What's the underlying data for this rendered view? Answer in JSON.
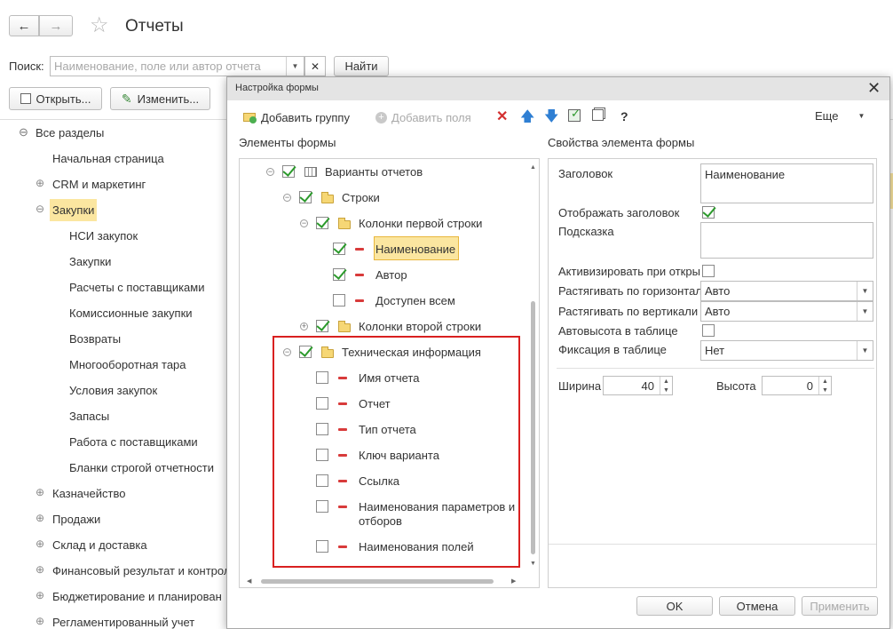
{
  "main": {
    "title": "Отчеты",
    "search_label": "Поиск:",
    "search_placeholder": "Наименование, поле или автор отчета",
    "find_button": "Найти",
    "open_button": "Открыть...",
    "edit_button": "Изменить...",
    "back_icon": "arrow-left-icon",
    "forward_icon": "arrow-right-icon",
    "star_icon": "star-icon"
  },
  "sections": {
    "root": "Все разделы",
    "items": [
      "Начальная страница",
      "CRM и маркетинг",
      "Закупки",
      "НСИ закупок",
      "Закупки",
      "Расчеты с поставщиками",
      "Комиссионные закупки",
      "Возвраты",
      "Многооборотная тара",
      "Условия закупок",
      "Запасы",
      "Работа с поставщиками",
      "Бланки строгой отчетности",
      "Казначейство",
      "Продажи",
      "Склад и доставка",
      "Финансовый результат и контрол",
      "Бюджетирование и планирован",
      "Регламентированный учет"
    ]
  },
  "dialog": {
    "title": "Настройка формы",
    "toolbar": {
      "add_group": "Добавить группу",
      "add_fields": "Добавить поля",
      "help": "?",
      "more": "Еще"
    },
    "left_header": "Элементы формы",
    "right_header": "Свойства элемента формы",
    "tree": [
      "Варианты отчетов",
      "Строки",
      "Колонки первой строки",
      "Наименование",
      "Автор",
      "Доступен всем",
      "Колонки второй строки",
      "Техническая информация",
      "Имя отчета",
      "Отчет",
      "Тип отчета",
      "Ключ варианта",
      "Ссылка",
      "Наименования параметров и",
      "отборов",
      "Наименования полей"
    ],
    "props": {
      "caption_label": "Заголовок",
      "caption_value": "Наименование",
      "show_caption_label": "Отображать заголовок",
      "hint_label": "Подсказка",
      "activate_label": "Активизировать при откры",
      "stretch_h_label": "Растягивать по горизонтал",
      "stretch_h_value": "Авто",
      "stretch_v_label": "Растягивать по вертикали",
      "stretch_v_value": "Авто",
      "autoheight_label": "Автовысота в таблице",
      "fix_label": "Фиксация в таблице",
      "fix_value": "Нет",
      "width_label": "Ширина",
      "width_value": "40",
      "height_label": "Высота",
      "height_value": "0"
    },
    "buttons": {
      "ok": "OK",
      "cancel": "Отмена",
      "apply": "Применить"
    }
  },
  "colors": {
    "selected_bg": "#fbe6a0",
    "selected_border": "#e8b63c",
    "highlight_frame": "#d92020",
    "dialog_title_bg": "#e4e4e4"
  }
}
